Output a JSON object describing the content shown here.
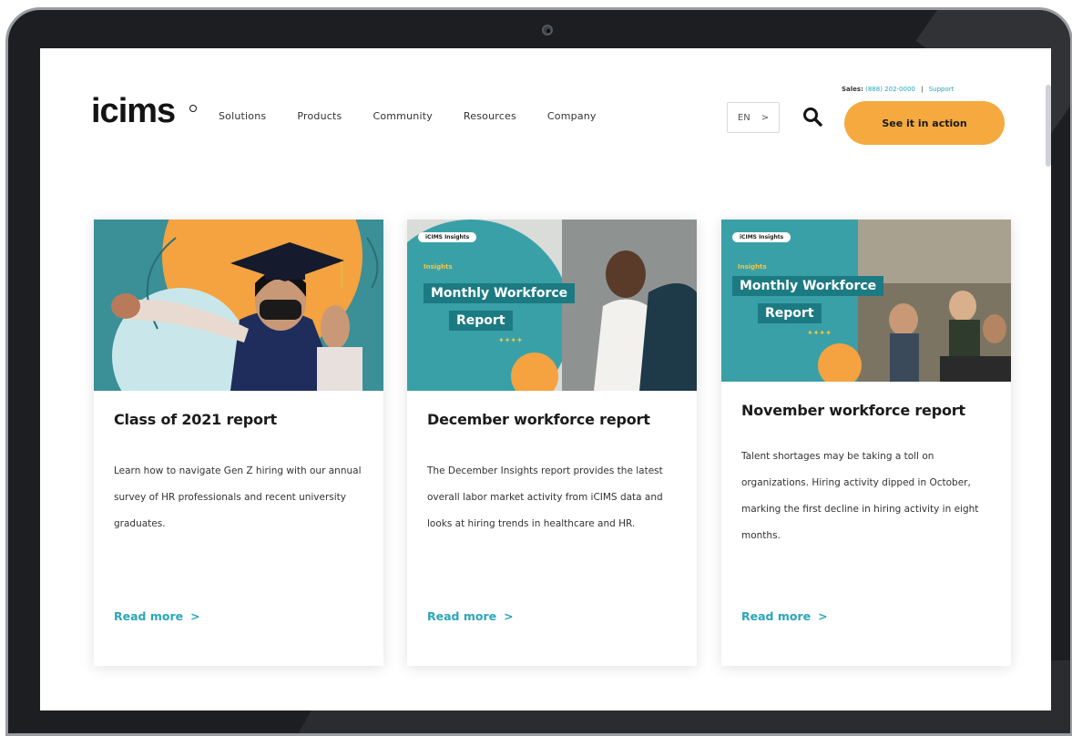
{
  "header": {
    "logo": "icims",
    "nav": [
      "Solutions",
      "Products",
      "Community",
      "Resources",
      "Company"
    ],
    "language_short": "EN",
    "language_arrow": ">",
    "sales_label": "Sales:",
    "sales_phone": "(888) 202-0000",
    "separator": "|",
    "support_link": "Support",
    "cta": "See it in action"
  },
  "cards": [
    {
      "title": "Class of 2021 report",
      "body": "Learn how to navigate Gen Z hiring with our annual survey of HR professionals and recent university graduates.",
      "link": "Read more",
      "link_arrow": ">"
    },
    {
      "title": "December workforce report",
      "body": "The December Insights report provides the latest overall labor market activity from iCIMS data and looks at hiring trends in healthcare and HR.",
      "link": "Read more",
      "link_arrow": ">",
      "image": {
        "tag": "iCIMS Insights",
        "kicker": "Insights",
        "line1": "Monthly Workforce",
        "line2": "Report",
        "stars": "✦✦✦✦"
      }
    },
    {
      "title": "November workforce report",
      "body": "Talent shortages may be taking a toll on organizations. Hiring activity dipped in October, marking the first decline in hiring activity in eight months.",
      "link": "Read more",
      "link_arrow": ">",
      "image": {
        "tag": "iCIMS Insights",
        "kicker": "Insights",
        "line1": "Monthly Workforce",
        "line2": "Report",
        "stars": "✦✦✦✦"
      }
    }
  ],
  "colors": {
    "accent_teal": "#2aa6ba",
    "cta_orange": "#f5a93f",
    "image_teal": "#3aa0a8"
  }
}
